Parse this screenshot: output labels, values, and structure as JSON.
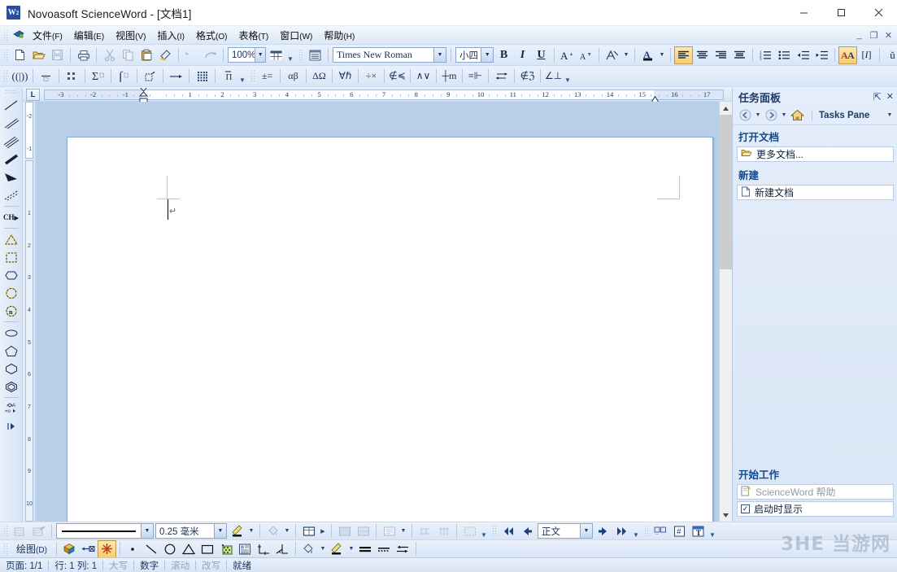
{
  "window": {
    "title": "Novoasoft ScienceWord - [文档1]",
    "logo": "W2",
    "minimize": "—",
    "maximize": "▢",
    "close": "✕"
  },
  "mdi": {
    "minimize": "_",
    "restore": "❐",
    "close": "✕"
  },
  "menu": {
    "items": [
      {
        "label": "文件",
        "mnemonic": "(F)"
      },
      {
        "label": "编辑",
        "mnemonic": "(E)"
      },
      {
        "label": "视图",
        "mnemonic": "(V)"
      },
      {
        "label": "插入",
        "mnemonic": "(I)"
      },
      {
        "label": "格式",
        "mnemonic": "(O)"
      },
      {
        "label": "表格",
        "mnemonic": "(T)"
      },
      {
        "label": "窗口",
        "mnemonic": "(W)"
      },
      {
        "label": "帮助",
        "mnemonic": "(H)"
      }
    ]
  },
  "standard_toolbar": {
    "zoom_value": "100%",
    "font_value": "Times New Roman",
    "size_value": "小四",
    "bold": "B",
    "italic": "I",
    "underline": "U",
    "icons": [
      "new-document-icon",
      "open-folder-icon",
      "save-icon",
      "print-icon",
      "cut-icon",
      "copy-icon",
      "paste-icon",
      "format-painter-icon",
      "undo-icon",
      "redo-icon",
      "table-icon",
      "task-pane-icon"
    ]
  },
  "format_toolbar": {
    "icons": [
      "grow-font-icon",
      "shrink-font-icon",
      "highlight-icon",
      "font-color-icon",
      "align-left-icon",
      "align-center-icon",
      "align-right-icon",
      "align-justify-icon",
      "numbered-list-icon",
      "bulleted-list-icon",
      "decrease-indent-icon",
      "increase-indent-icon",
      "font-dialog-icon",
      "italic-math-icon",
      "accent-icon"
    ]
  },
  "math_toolbar": {
    "icons": [
      "brackets-icon",
      "fraction-icon",
      "matrix-icon",
      "summation-icon",
      "integral-icon",
      "boxed-icon",
      "arrow-over-icon",
      "grid-icon",
      "overbar-icon",
      "plus-minus-equal-icon",
      "greek-lower-icon",
      "greek-upper-icon",
      "logic-icon",
      "operators-icon",
      "set-icon",
      "arrows-icon",
      "misc-math-icon",
      "relations-icon",
      "double-arrow-icon",
      "not-member-icon",
      "angle-perp-icon"
    ]
  },
  "ruler": {
    "horizontal_labels": [
      "-3",
      "-2",
      "-1",
      "1",
      "2",
      "3",
      "4",
      "5",
      "6",
      "7",
      "8",
      "9",
      "10",
      "11",
      "12",
      "13",
      "14",
      "15",
      "16",
      "17"
    ],
    "vertical_labels": [
      "-2",
      "-1",
      "1",
      "2",
      "3",
      "4",
      "5",
      "6",
      "7",
      "8",
      "9",
      "10"
    ],
    "tab_selector": "L"
  },
  "drawing_left_bar": {
    "icons": [
      "line-thin-icon",
      "line-double-icon",
      "line-triple-icon",
      "line-thick-icon",
      "arrow-solid-icon",
      "line-dashed-icon",
      "chemistry-ch-icon",
      "triangle-icon",
      "square-icon",
      "hexagon-flat-icon",
      "circle-dashed-icon",
      "n-gon-icon",
      "ellipse-icon",
      "pentagon-icon",
      "hexagon-icon",
      "octagon-icon",
      "chem-structure-icon",
      "more-shapes-icon"
    ]
  },
  "taskpane": {
    "title": "任务面板",
    "pin": "⊞",
    "close": "✕",
    "nav_back": "back-icon",
    "nav_forward": "forward-icon",
    "nav_home": "home-icon",
    "nav_label": "Tasks Pane",
    "sections": [
      {
        "title": "打开文档",
        "items": [
          {
            "label": "更多文档...",
            "icon": "open-folder-icon"
          }
        ]
      },
      {
        "title": "新建",
        "items": [
          {
            "label": "新建文档",
            "icon": "new-document-icon"
          }
        ]
      }
    ],
    "bottom_section": {
      "title": "开始工作",
      "items": [
        {
          "label": "ScienceWord 帮助",
          "icon": "help-icon",
          "dim": true
        },
        {
          "label": "启动时显示",
          "icon": "checkbox-checked",
          "checked": "✓"
        }
      ]
    }
  },
  "document": {
    "paragraph_mark": "↵"
  },
  "drawing_toolbar": {
    "label": "绘图",
    "mnemonic": "(D)",
    "line_width_value": "0.25 毫米",
    "style_value": "正文",
    "icons": [
      "insert-table-icon",
      "draw-table-icon",
      "line-style-icon",
      "pencil-color-icon",
      "fill-color-icon",
      "borders-icon",
      "shading-icon",
      "pattern-icon",
      "textbox-icon",
      "merge-cells-icon",
      "split-cells-icon",
      "table-grid-icon",
      "first-icon",
      "prev-icon",
      "next-icon",
      "last-icon",
      "field-icon",
      "hash-icon",
      "text-format-icon",
      "3d-shape-icon",
      "connector-icon",
      "starburst-icon",
      "dot-icon",
      "line-icon",
      "circle-icon",
      "triangle-icon",
      "rectangle-icon",
      "image-icon",
      "document-icon",
      "axes-icon",
      "axes-2-icon",
      "fill-icon",
      "highlighter-icon",
      "thick-line-icon",
      "dashed-line-icon",
      "arrows-both-icon"
    ]
  },
  "statusbar": {
    "cells": [
      {
        "text": "页面: 1/1",
        "dim": false
      },
      {
        "text": "行: 1 列: 1",
        "dim": false
      },
      {
        "text": "大写",
        "dim": true
      },
      {
        "text": "数字",
        "dim": false
      },
      {
        "text": "滚动",
        "dim": true
      },
      {
        "text": "改写",
        "dim": true
      },
      {
        "text": "就绪",
        "dim": false
      }
    ]
  },
  "watermark": "3HE 当游网",
  "colors": {
    "titlebar_bg": "#ffffff",
    "chrome_blue": "#dce7f5",
    "accent_dark_blue": "#1b3a6b",
    "section_heading": "#12498f",
    "page_white": "#ffffff"
  }
}
